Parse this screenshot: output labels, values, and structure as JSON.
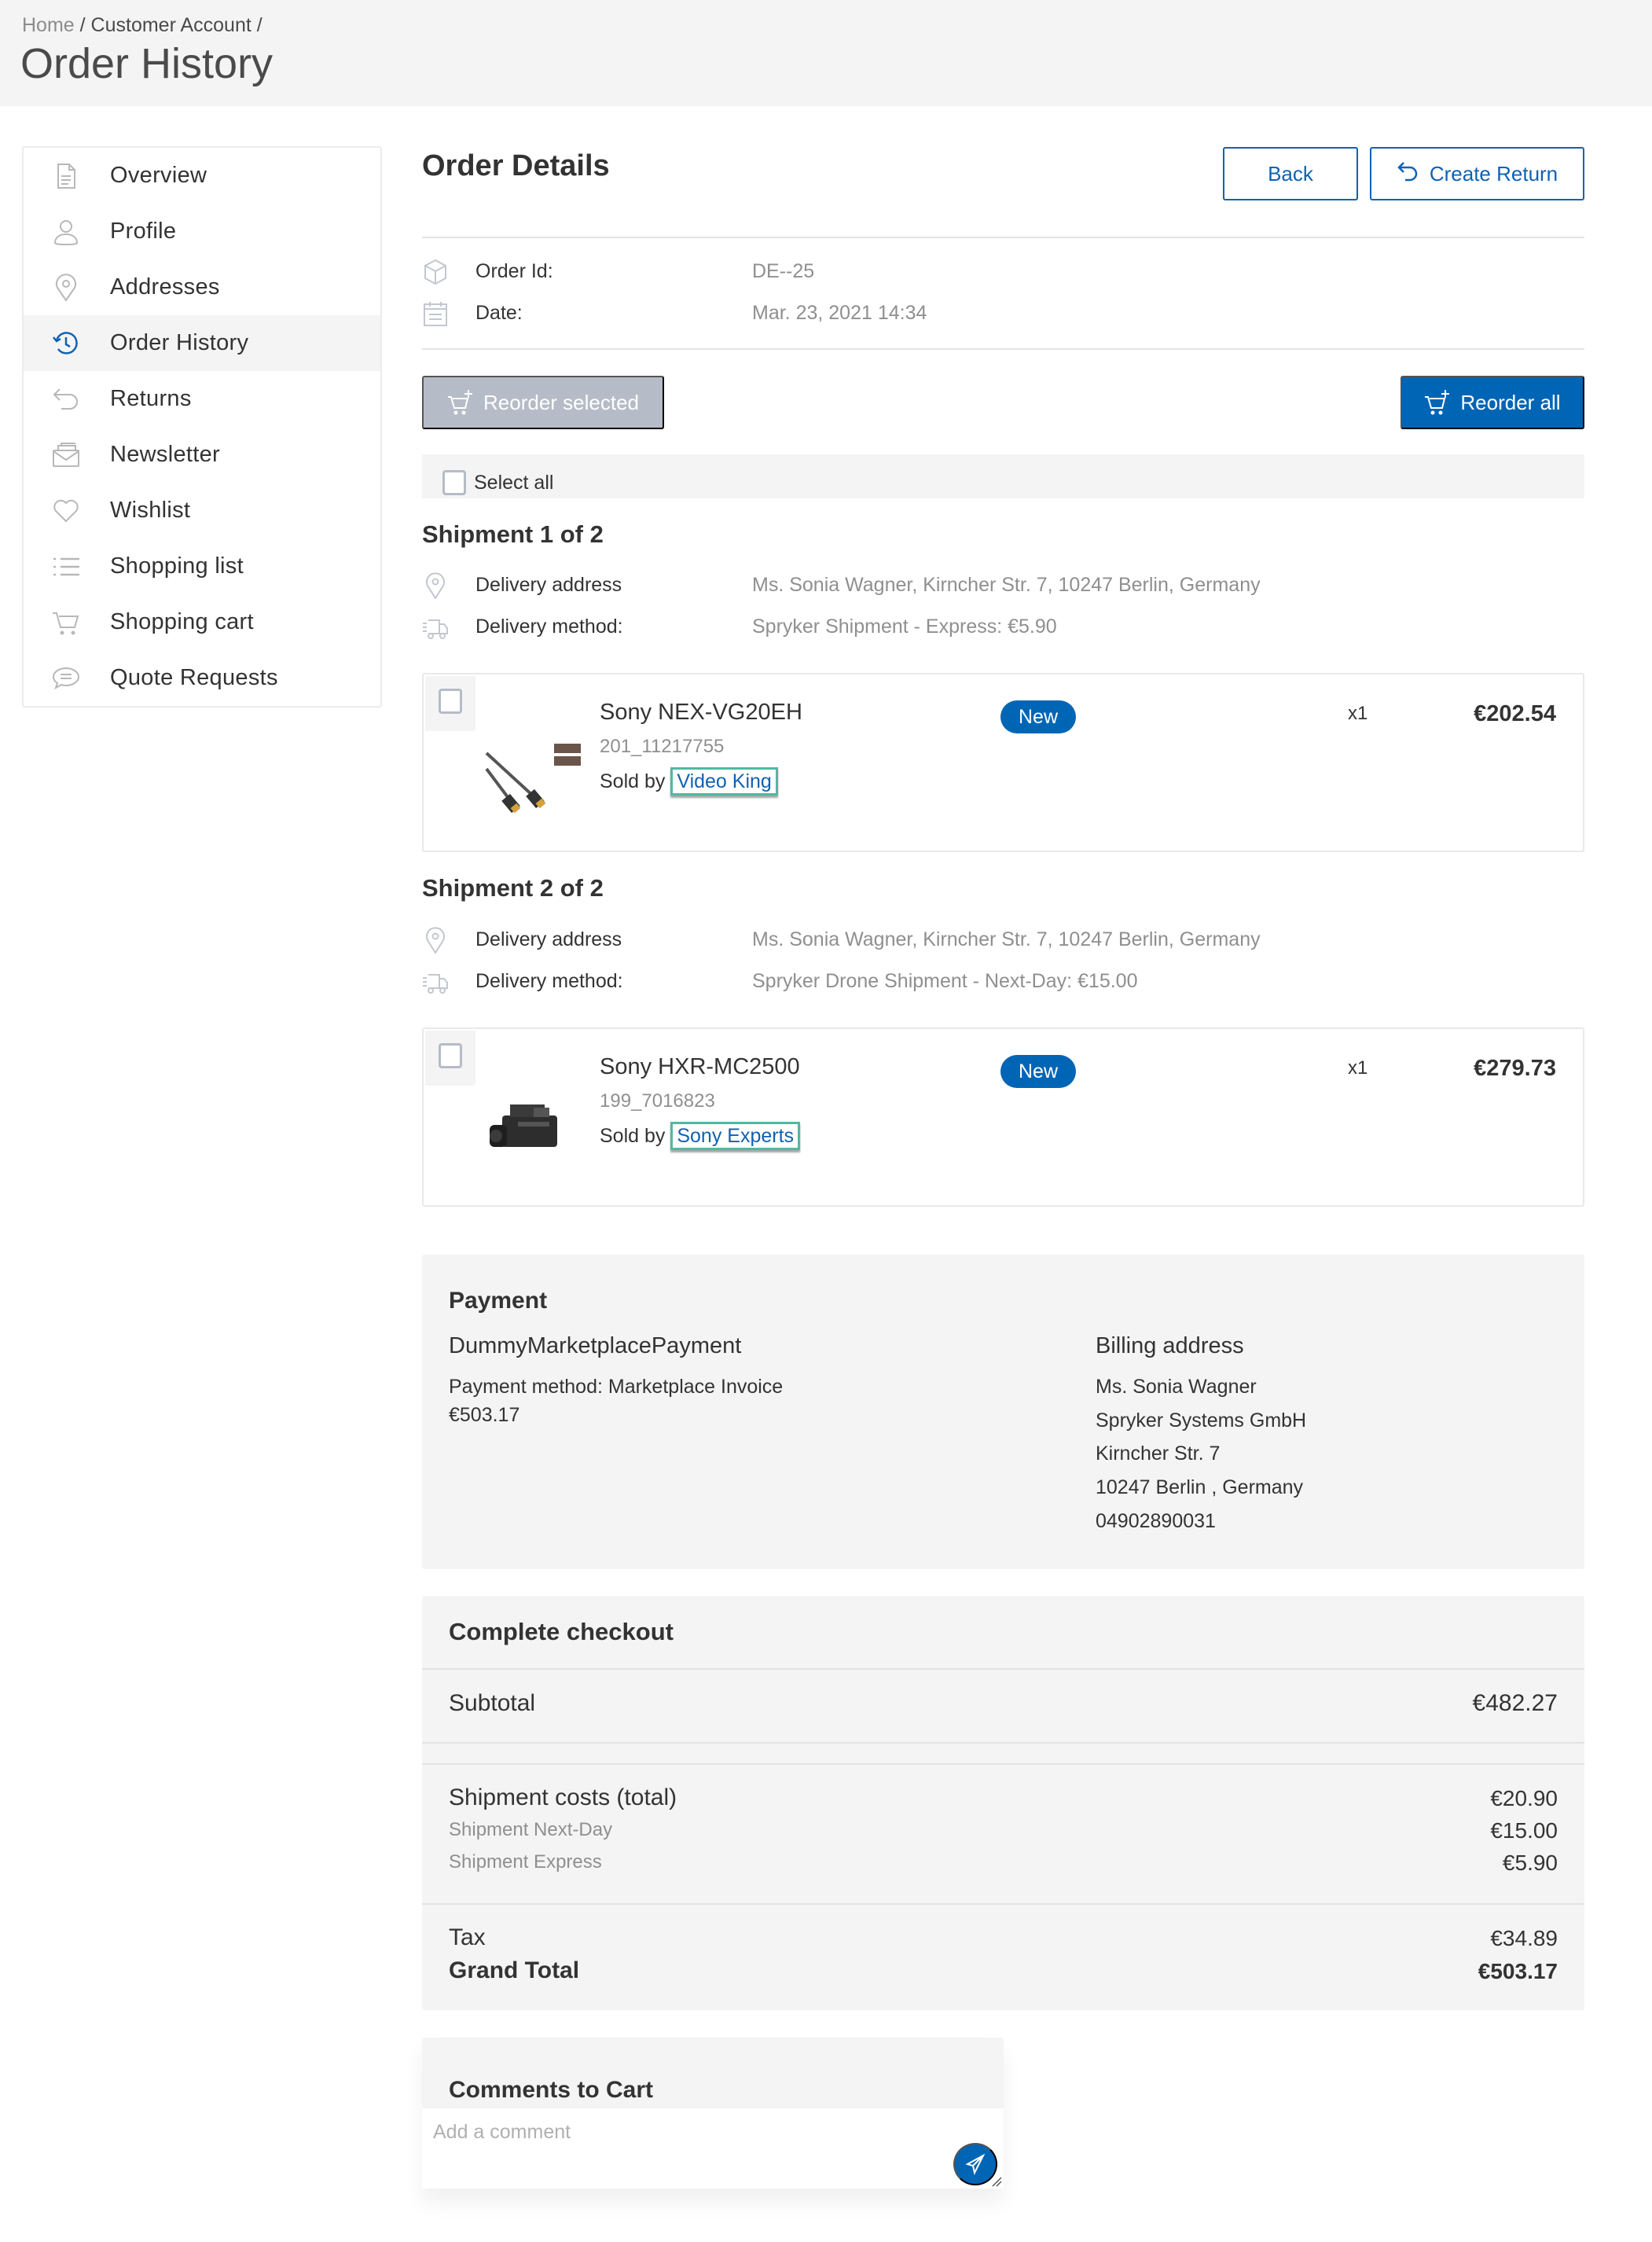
{
  "header": {
    "breadcrumb": [
      {
        "label": "Home"
      },
      {
        "label": "Customer Account"
      }
    ],
    "separator": "/",
    "title": "Order History"
  },
  "sidebar": {
    "items": [
      {
        "label": "Overview",
        "icon": "document-icon",
        "active": false
      },
      {
        "label": "Profile",
        "icon": "user-icon",
        "active": false
      },
      {
        "label": "Addresses",
        "icon": "map-pin-icon",
        "active": false
      },
      {
        "label": "Order History",
        "icon": "history-icon",
        "active": true
      },
      {
        "label": "Returns",
        "icon": "return-arrow-icon",
        "active": false
      },
      {
        "label": "Newsletter",
        "icon": "envelope-icon",
        "active": false
      },
      {
        "label": "Wishlist",
        "icon": "heart-icon",
        "active": false
      },
      {
        "label": "Shopping list",
        "icon": "list-icon",
        "active": false
      },
      {
        "label": "Shopping cart",
        "icon": "cart-icon",
        "active": false
      },
      {
        "label": "Quote Requests",
        "icon": "chat-bubble-icon",
        "active": false
      }
    ]
  },
  "order": {
    "title": "Order Details",
    "back_label": "Back",
    "create_return_label": "Create Return",
    "order_id_label": "Order Id:",
    "order_id": "DE--25",
    "date_label": "Date:",
    "date": "Mar. 23, 2021 14:34",
    "reorder_selected_label": "Reorder selected",
    "reorder_all_label": "Reorder all",
    "select_all_label": "Select all"
  },
  "shipments": [
    {
      "title": "Shipment 1 of 2",
      "address_label": "Delivery address",
      "address": "Ms. Sonia Wagner, Kirncher Str. 7, 10247 Berlin, Germany",
      "method_label": "Delivery method:",
      "method": "Spryker Shipment - Express: €5.90",
      "item": {
        "name": "Sony NEX-VG20EH",
        "sku": "201_11217755",
        "sold_by_label": "Sold by",
        "merchant": "Video King",
        "badge": "New",
        "quantity": "x1",
        "price": "€202.54",
        "image": "hdmi-cable"
      }
    },
    {
      "title": "Shipment 2 of 2",
      "address_label": "Delivery address",
      "address": "Ms. Sonia Wagner, Kirncher Str. 7, 10247 Berlin, Germany",
      "method_label": "Delivery method:",
      "method": "Spryker Drone Shipment - Next-Day: €15.00",
      "item": {
        "name": "Sony HXR-MC2500",
        "sku": "199_7016823",
        "sold_by_label": "Sold by",
        "merchant": "Sony Experts",
        "badge": "New",
        "quantity": "x1",
        "price": "€279.73",
        "image": "camcorder"
      }
    }
  ],
  "payment": {
    "title": "Payment",
    "provider": "DummyMarketplacePayment",
    "method": "Payment method: Marketplace Invoice",
    "amount": "€503.17",
    "billing_title": "Billing address",
    "billing_lines": [
      "Ms. Sonia Wagner",
      "Spryker Systems GmbH",
      "Kirncher Str. 7",
      "10247 Berlin , Germany",
      "04902890031"
    ]
  },
  "summary": {
    "title": "Complete checkout",
    "subtotal_label": "Subtotal",
    "subtotal": "€482.27",
    "shipment_total_label": "Shipment costs (total)",
    "shipment_total": "€20.90",
    "shipment_lines": [
      {
        "label": "Shipment Next-Day",
        "value": "€15.00"
      },
      {
        "label": "Shipment Express",
        "value": "€5.90"
      }
    ],
    "tax_label": "Tax",
    "tax": "€34.89",
    "grand_total_label": "Grand Total",
    "grand_total": "€503.17"
  },
  "comments": {
    "title": "Comments to Cart",
    "placeholder": "Add a comment",
    "value": ""
  },
  "colors": {
    "primary": "#0065b5",
    "link": "#0f62b3",
    "disabled_button": "#b5bcc7",
    "panel_bg": "#f4f4f4",
    "highlight_outline": "#52b8a0"
  }
}
